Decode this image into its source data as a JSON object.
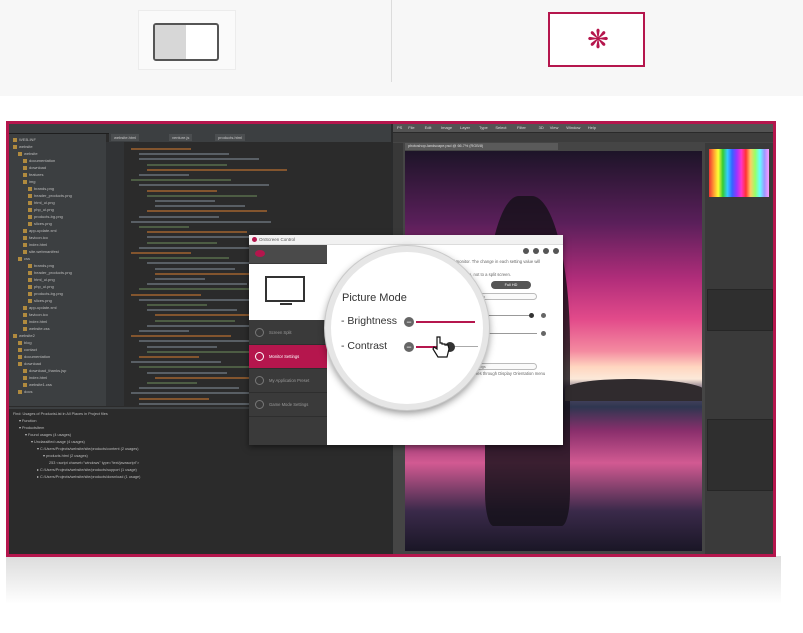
{
  "mode_buttons": {
    "split": {
      "icon": "split-screen-icon",
      "selected": false
    },
    "screen": {
      "icon": "burst-icon",
      "selected": true,
      "accent": "#b5164d"
    }
  },
  "ide": {
    "tabs": [
      "website.html",
      "venture.js",
      "products.html"
    ],
    "tree": [
      "WEB-INF",
      "website",
      "website",
      "documentation",
      "download",
      "features",
      "img",
      "brands.png",
      "header_products.png",
      "html_ui.png",
      "php_ui.png",
      "products-bg.png",
      "slices.png",
      "app-update.xml",
      "favicon.ico",
      "index.html",
      "site.webmanifest",
      "css",
      "brands.png",
      "header_products.png",
      "html_ui.png",
      "php_ui.png",
      "products-bg.png",
      "slices.png",
      "app-update.xml",
      "favicon.ico",
      "index.html",
      "website.css",
      "website2",
      "blog",
      "contact",
      "documentation",
      "download",
      "download_thanks.jsp",
      "index.html",
      "website1.css",
      "docs"
    ],
    "find": [
      "Find: Usages of ProductsList in All Places in Project files",
      "▾ Function",
      "▾ ProductsItem",
      "▾ Found usages (4 usages)",
      "▾ Unclassified usage (4 usages)",
      "▾ C:/Users/Projects/website/site/products/content (2 usages)",
      "▾ products.html (2 usages)",
      "253 <script charset=\"windows\" type=\"text/javascript\">",
      "▸ C:/Users/Projects/website/site/products/support (1 usage)",
      "▸ C:/Users/Projects/website/site/products/download (1 usage)"
    ]
  },
  "ps": {
    "menus": [
      "PS",
      "File",
      "Edit",
      "Image",
      "Layer",
      "Type",
      "Select",
      "Filter",
      "3D",
      "View",
      "Window",
      "Help"
    ],
    "doc_tab": "photoshop-landscape.psd @ 66.7% (RGB/8)"
  },
  "osc": {
    "title": "OnScreen Control",
    "nav": [
      "Screen Split",
      "Monitor Settings",
      "My Application Preset",
      "Game Mode Settings"
    ],
    "active_nav": 1,
    "description_lines": [
      "selected monitor. The change in each setting value will",
      "entire screen, not to a split screen.",
      "Custom",
      "Full HD",
      "Settings",
      "Flashes through Display Orientation menu"
    ]
  },
  "magnifier": {
    "title": "Picture Mode",
    "brightness_label": "- Brightness",
    "contrast_label": "- Contrast",
    "brightness_level": 0.95,
    "contrast_level": 0.55
  }
}
